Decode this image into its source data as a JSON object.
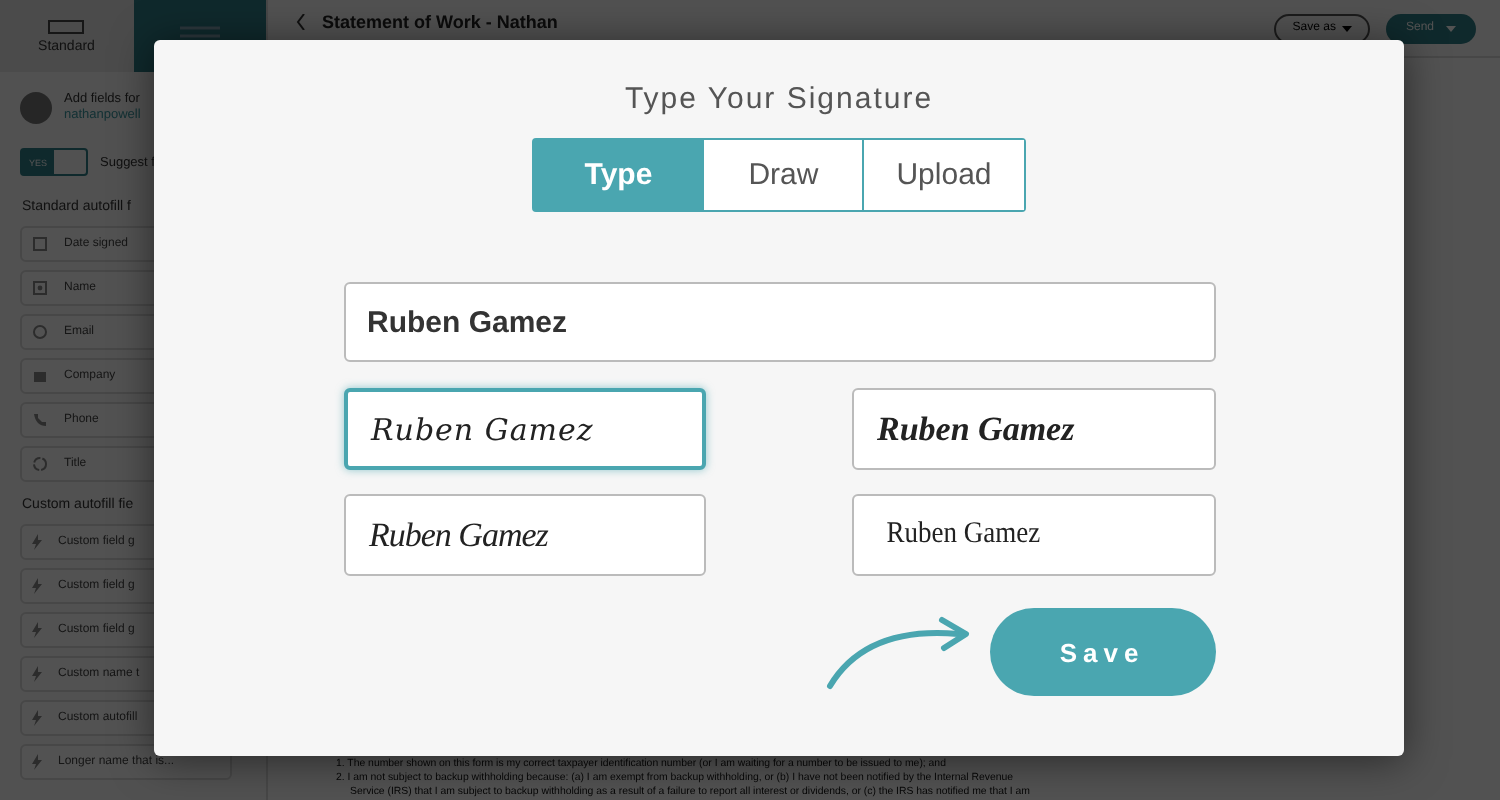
{
  "sidebar": {
    "tabs": [
      {
        "kind": "text",
        "label": "Standard",
        "selected": false
      },
      {
        "kind": "icon",
        "selected": true
      }
    ],
    "owner": {
      "heading": "Add fields for",
      "email": "nathanpowell"
    },
    "suggest": {
      "toggle": "YES",
      "on": true,
      "label": "Suggest f"
    },
    "standard_heading": "Standard autofill f",
    "standard_fields": [
      {
        "kind": "date",
        "label": "Date signed"
      },
      {
        "kind": "person",
        "label": "Name"
      },
      {
        "kind": "email",
        "label": "Email"
      },
      {
        "kind": "company",
        "label": "Company"
      },
      {
        "kind": "phone",
        "label": "Phone"
      },
      {
        "kind": "title",
        "label": "Title"
      }
    ],
    "custom_heading": "Custom autofill fie",
    "custom_fields": [
      "Custom field g",
      "Custom field g",
      "Custom field g",
      "Custom name t",
      "Custom autofill",
      "Longer name that is..."
    ]
  },
  "header": {
    "title": "Statement of Work - Nathan",
    "save_as": "Save as",
    "send": "Send"
  },
  "document_lines": [
    "1. The number shown on this form is my correct taxpayer identification number (or I am waiting for a number to be issued to me); and",
    "2. I am not subject to backup withholding because: (a) I am exempt from backup withholding, or (b) I have not been notified by the Internal Revenue",
    "Service (IRS) that I am subject to backup withholding as a result of a failure to report all interest or dividends, or (c) the IRS has notified me that I am"
  ],
  "modal": {
    "title": "Type Your Signature",
    "tabs": [
      {
        "label": "Type",
        "selected": true
      },
      {
        "label": "Draw",
        "selected": false
      },
      {
        "label": "Upload",
        "selected": false
      }
    ],
    "name_value": "Ruben Gamez",
    "signatures": [
      {
        "text": "Ruben Gamez",
        "kind": "thin",
        "selected": true
      },
      {
        "text": "Ruben Gamez",
        "kind": "bold",
        "selected": false
      },
      {
        "text": "Ruben Gamez",
        "kind": "loose",
        "selected": false
      },
      {
        "text": "Ruben Gamez",
        "kind": "upright",
        "selected": false
      }
    ],
    "save": "Save"
  }
}
